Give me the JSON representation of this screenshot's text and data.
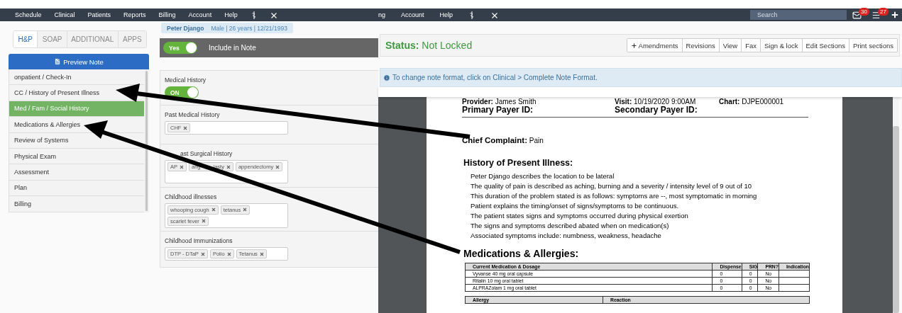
{
  "left_screen": {
    "nav": {
      "items": [
        "Schedule",
        "Clinical",
        "Patients",
        "Reports",
        "Billing",
        "Account",
        "Help"
      ]
    },
    "tabs": [
      {
        "label": "H&P",
        "selected": true
      },
      {
        "label": "SOAP",
        "selected": false
      },
      {
        "label": "ADDITIONAL",
        "selected": false
      },
      {
        "label": "APPS",
        "selected": false
      }
    ],
    "preview_button": "Preview Note",
    "sections": [
      {
        "label": "onpatient / Check-In",
        "selected": false
      },
      {
        "label": "CC / History of Present Illness",
        "selected": false
      },
      {
        "label": "Med / Fam / Social History",
        "selected": true
      },
      {
        "label": "Medications & Allergies",
        "selected": false
      },
      {
        "label": "Review of Systems",
        "selected": false
      },
      {
        "label": "Physical Exam",
        "selected": false
      },
      {
        "label": "Assessment",
        "selected": false
      },
      {
        "label": "Plan",
        "selected": false
      },
      {
        "label": "Billing",
        "selected": false
      }
    ],
    "patient": {
      "name": "Peter Django",
      "details": "Male | 26 years | 12/21/1993"
    },
    "include_toggle": {
      "label": "Yes",
      "on": true,
      "caption": "Include in Note"
    },
    "medical_history": {
      "label": "Medical History",
      "toggle": {
        "label": "ON",
        "on": true
      }
    },
    "fields": [
      {
        "label": "Past Medical History",
        "tags": [
          "CHF"
        ]
      },
      {
        "label": "ast Surgical History",
        "tags": [
          "AP",
          {
            "parts": [
              "ang",
              "lasty"
            ]
          },
          "appendectomy"
        ],
        "tall": true
      },
      {
        "label": "Childhood illnesses",
        "tags": [
          "whooping cough",
          "tetanus",
          "scarlet fever"
        ],
        "tall": true
      },
      {
        "label": "Childhood Immunizations",
        "tags": [
          "DTP - DTaP",
          "Polio",
          "Tetanus"
        ]
      }
    ]
  },
  "right_screen": {
    "nav": {
      "items": [
        "ng",
        "Account",
        "Help"
      ],
      "search": {
        "placeholder": "Search"
      },
      "mail_count": "30",
      "list_count": "27"
    },
    "status": {
      "label": "Status:",
      "value": "Not Locked"
    },
    "actions": [
      {
        "label": "Amendments",
        "kind": "add"
      },
      {
        "label": "Revisions"
      },
      {
        "label": "View"
      },
      {
        "label": "Fax"
      },
      {
        "label": "Sign & lock"
      },
      {
        "label": "Edit Sections"
      },
      {
        "label": "Print sections"
      }
    ],
    "info": "To change note format, click on Clinical > Complete Note Format.",
    "note": {
      "header": [
        [
          {
            "label": "Provider:",
            "value": "James Smith"
          },
          {
            "label": "Visit:",
            "value": "10/19/2020 9:00AM"
          },
          {
            "label": "Chart:",
            "value": "DJPE000001"
          }
        ],
        [
          {
            "label": "Primary Payer ID:"
          },
          {
            "label": "Secondary Payer ID:"
          }
        ]
      ],
      "chief_complaint": {
        "label": "Chief Complaint:",
        "value": "Pain"
      },
      "hpi": {
        "title": "History of Present Illness:",
        "lines": [
          "Peter Django describes the location to be lateral",
          "The quality of pain is described as aching, burning and a severity / intensity level of 9 out of 10",
          "This duration of the problem stated is as follows: symptoms are --, most symptomatic in morning",
          "Patient explains the timing/onset of signs/symptoms to be continuous.",
          "The patient states signs and symptoms occurred during physical exertion",
          "The signs and symptoms described abated when on medication(s)",
          "Associated symptoms include: numbness, weakness, headache"
        ]
      },
      "medications": {
        "title": "Medications & Allergies:",
        "columns": [
          "Current Medication & Dosage",
          "Dispense",
          "SIG",
          "PRN?",
          "Indication"
        ],
        "rows": [
          [
            "Vyvanse 40 mg oral capsule",
            "0",
            "0",
            "No",
            ""
          ],
          [
            "Ritalin 10 mg oral tablet",
            "0",
            "0",
            "No",
            ""
          ],
          [
            "ALPRAZolam 1 mg oral tablet",
            "0",
            "0",
            "No",
            ""
          ]
        ]
      },
      "allergies": {
        "columns": [
          "Allergy",
          "Reaction"
        ]
      }
    }
  }
}
